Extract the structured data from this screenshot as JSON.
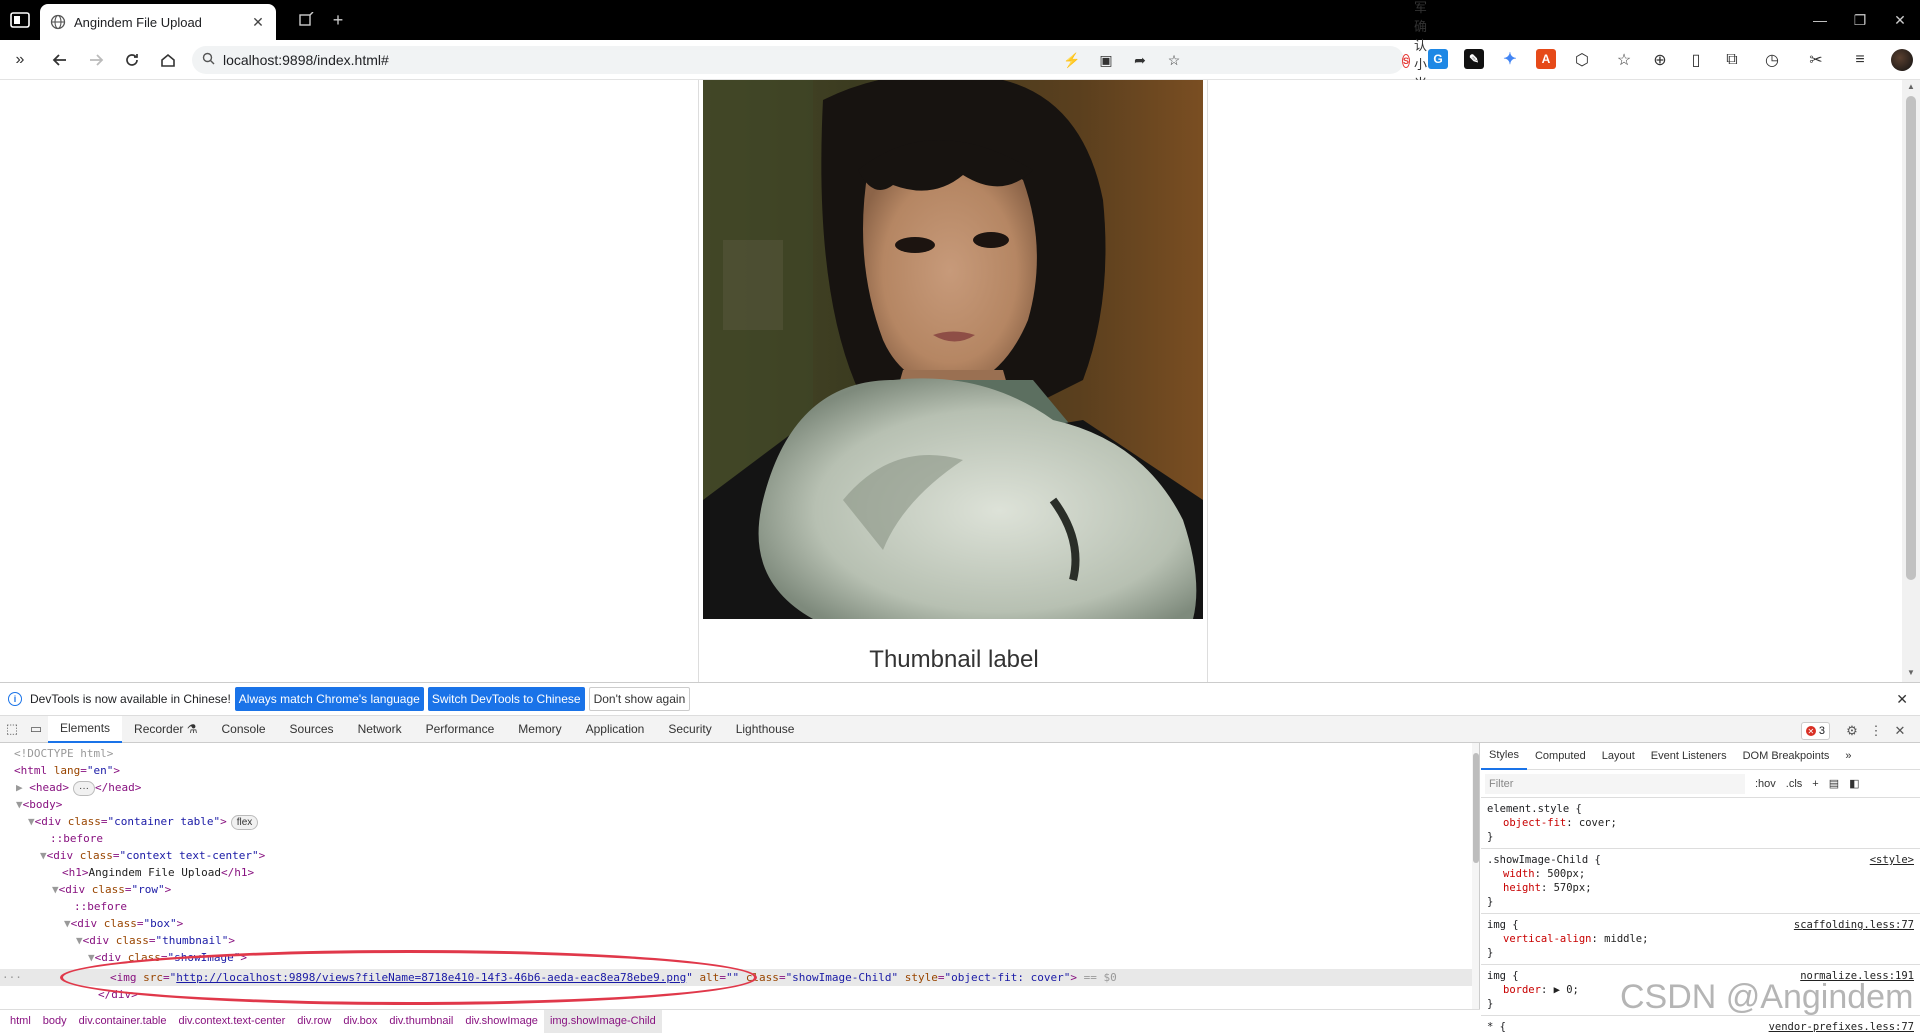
{
  "tab": {
    "title": "Angindem File Upload",
    "close": "✕",
    "new_tab": "+"
  },
  "window": {
    "minimize": "—",
    "restore": "❐",
    "close": "✕"
  },
  "toolbar": {
    "url": "localhost:9898/index.html#",
    "news": "雷军确认小米15涨价"
  },
  "page": {
    "thumbnail_label": "Thumbnail label"
  },
  "infobar": {
    "message": "DevTools is now available in Chinese!",
    "btn_match": "Always match Chrome's language",
    "btn_switch": "Switch DevTools to Chinese",
    "btn_dont": "Don't show again"
  },
  "devtools": {
    "tabs": [
      "Elements",
      "Recorder",
      "Console",
      "Sources",
      "Network",
      "Performance",
      "Memory",
      "Application",
      "Security",
      "Lighthouse"
    ],
    "error_count": "3"
  },
  "dom": {
    "doctype": "<!DOCTYPE html>",
    "html_open": "<html",
    "lang_attr": "lang",
    "lang_val": "\"en\"",
    "head": "<head>",
    "head_close": "</head>",
    "ellipsis": "···",
    "body": "<body>",
    "div1_class": "\"container table\"",
    "flex": "flex",
    "before": "::before",
    "div2_class": "\"context text-center\"",
    "h1_text": "Angindem File Upload",
    "div3_class": "\"row\"",
    "div4_class": "\"box\"",
    "div5_class": "\"thumbnail\"",
    "div6_class": "\"showImage\"",
    "img_src": "http://localhost:9898/views?fileName=8718e410-14f3-46b6-aeda-eac8ea78ebe9.png",
    "img_class": "\"showImage-Child\"",
    "img_style": "\"object-fit: cover\"",
    "eq_dollar": "== $0",
    "div_close": "</div>"
  },
  "breadcrumbs": [
    "html",
    "body",
    "div.container.table",
    "div.context.text-center",
    "div.row",
    "div.box",
    "div.thumbnail",
    "div.showImage",
    "img.showImage-Child"
  ],
  "styles": {
    "tabs": [
      "Styles",
      "Computed",
      "Layout",
      "Event Listeners",
      "DOM Breakpoints"
    ],
    "filter_placeholder": "Filter",
    "hov": ":hov",
    "cls": ".cls",
    "rules": {
      "element_style": {
        "selector": "element.style {",
        "prop": "object-fit",
        "value": "cover;"
      },
      "show_child": {
        "selector": ".showImage-Child {",
        "source": "<style>",
        "p1": "width",
        "v1": "500px;",
        "p2": "height",
        "v2": "570px;"
      },
      "img1": {
        "selector": "img {",
        "source": "scaffolding.less:77",
        "prop": "vertical-align",
        "value": "middle;"
      },
      "img2": {
        "selector": "img {",
        "source": "normalize.less:191",
        "prop": "border",
        "value": "▶ 0;"
      },
      "star": {
        "selector": "* {",
        "source": "vendor-prefixes.less:77"
      },
      "close_brace": "}"
    }
  },
  "watermark": "CSDN @Angindem"
}
